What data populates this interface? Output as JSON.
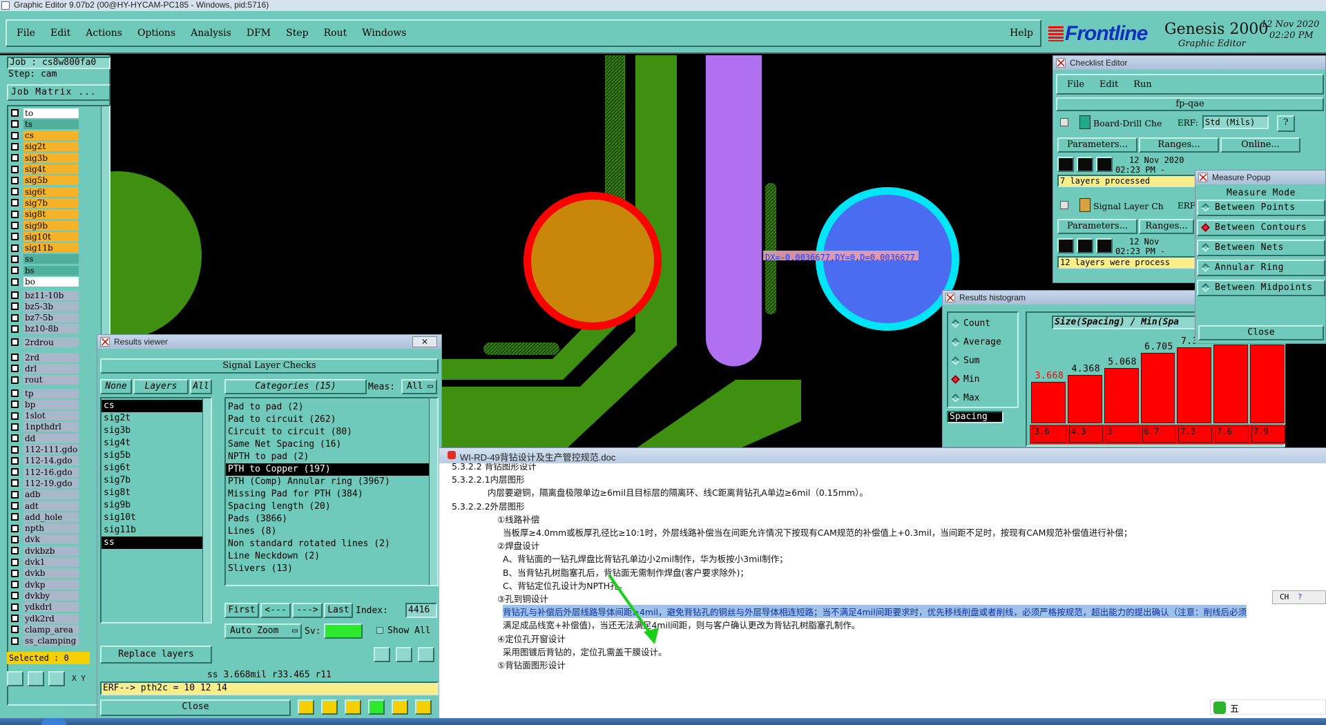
{
  "os_title": "Graphic Editor 9.07b2 (00@HY-HYCAM-PC185 - Windows, pid:5716)",
  "menu": [
    "File",
    "Edit",
    "Actions",
    "Options",
    "Analysis",
    "DFM",
    "Step",
    "Rout",
    "Windows"
  ],
  "help": "Help",
  "logo": {
    "brand": "Frontline",
    "product": "Genesis 2000",
    "subtitle": "Graphic Editor",
    "date": "12 Nov 2020",
    "time": "02:20 PM"
  },
  "job": {
    "job_label": "Job : cs8w800fa0",
    "step_label": "Step: cam",
    "matrix_button": "Job Matrix ..."
  },
  "layers_group1": [
    {
      "name": "to",
      "color": "#ffffff"
    },
    {
      "name": "ts",
      "color": "#4fb09e"
    },
    {
      "name": "cs",
      "color": "#f5b32a"
    },
    {
      "name": "sig2t",
      "color": "#f5b32a"
    },
    {
      "name": "sig3b",
      "color": "#f5b32a"
    },
    {
      "name": "sig4t",
      "color": "#f5b32a"
    },
    {
      "name": "sig5b",
      "color": "#f5b32a"
    },
    {
      "name": "sig6t",
      "color": "#f5b32a"
    },
    {
      "name": "sig7b",
      "color": "#f5b32a"
    },
    {
      "name": "sig8t",
      "color": "#f5b32a"
    },
    {
      "name": "sig9b",
      "color": "#f5b32a"
    },
    {
      "name": "sig10t",
      "color": "#f5b32a"
    },
    {
      "name": "sig11b",
      "color": "#f5b32a"
    },
    {
      "name": "ss",
      "color": "#4fb09e"
    },
    {
      "name": "bs",
      "color": "#4fb09e"
    },
    {
      "name": "bo",
      "color": "#ffffff"
    }
  ],
  "layers_group2": [
    {
      "name": "bz11-10b",
      "color": "#a8b8c8"
    },
    {
      "name": "bz5-3b",
      "color": "#a8b8c8"
    },
    {
      "name": "bz7-5b",
      "color": "#a8b8c8"
    },
    {
      "name": "bz10-8b",
      "color": "#a8b8c8"
    }
  ],
  "layers_group3": [
    {
      "name": "2rdrou",
      "color": "#a8b8c8"
    }
  ],
  "layers_group4": [
    {
      "name": "2rd",
      "color": "#a8b8c8"
    },
    {
      "name": "drl",
      "color": "#a8b8c8"
    },
    {
      "name": "rout",
      "color": "#a8b8c8"
    }
  ],
  "layers_group5": [
    {
      "name": "tp",
      "color": "#a8b8c8"
    },
    {
      "name": "bp",
      "color": "#a8b8c8"
    },
    {
      "name": "1slot",
      "color": "#a8b8c8"
    },
    {
      "name": "1npthdrl",
      "color": "#a8b8c8"
    },
    {
      "name": "dd",
      "color": "#a8b8c8"
    },
    {
      "name": "112-111.gdo",
      "color": "#a8b8c8"
    },
    {
      "name": "112-14.gdo",
      "color": "#a8b8c8"
    },
    {
      "name": "112-16.gdo",
      "color": "#a8b8c8"
    },
    {
      "name": "112-19.gdo",
      "color": "#a8b8c8"
    },
    {
      "name": "adb",
      "color": "#a8b8c8"
    },
    {
      "name": "adt",
      "color": "#a8b8c8"
    },
    {
      "name": "add_hole",
      "color": "#a8b8c8"
    },
    {
      "name": "npth",
      "color": "#a8b8c8"
    },
    {
      "name": "dvk",
      "color": "#a8b8c8"
    },
    {
      "name": "dvkbzb",
      "color": "#a8b8c8"
    },
    {
      "name": "dvk1",
      "color": "#a8b8c8"
    },
    {
      "name": "dvkb",
      "color": "#a8b8c8"
    },
    {
      "name": "dvkp",
      "color": "#a8b8c8"
    },
    {
      "name": "dvkby",
      "color": "#a8b8c8"
    },
    {
      "name": "ydkdrl",
      "color": "#a8b8c8"
    },
    {
      "name": "ydk2rd",
      "color": "#a8b8c8"
    },
    {
      "name": "clamp_area",
      "color": "#a8b8c8"
    },
    {
      "name": "ss_clamping",
      "color": "#a8b8c8"
    }
  ],
  "selected": "Selected : 0",
  "measure_text": "DX=-0.0036677,DY=0,D=0.0036677",
  "results_viewer": {
    "title": "Results viewer",
    "header": "Signal Layer Checks",
    "none_btn": "None",
    "layers_btn": "Layers",
    "all_btn": "All",
    "categories_btn": "Categories (15)",
    "meas_label": "Meas:",
    "meas_value": "All",
    "layers": [
      "cs",
      "sig2t",
      "sig3b",
      "sig4t",
      "sig5b",
      "sig6t",
      "sig7b",
      "sig8t",
      "sig9b",
      "sig10t",
      "sig11b",
      "ss"
    ],
    "categories": [
      "Pad to pad (2)",
      "Pad to circuit (262)",
      "Circuit to circuit (80)",
      "Same Net Spacing (16)",
      "NPTH to pad (2)",
      "PTH to Copper (197)",
      "PTH (Comp) Annular ring (3967)",
      "Missing Pad for PTH (384)",
      "Spacing length (20)",
      "Pads (3866)",
      "Lines (8)",
      "Non standard rotated lines (2)",
      "Line Neckdown (2)",
      "Slivers (13)"
    ],
    "selected_category": "PTH to Copper (197)",
    "nav": {
      "first": "First",
      "prev": "<---",
      "next": "--->",
      "last": "Last",
      "index_label": "Index:",
      "index_value": "4416"
    },
    "auto_zoom": "Auto Zoom",
    "sv_label": "Sv:",
    "show_all": "Show All",
    "replace_layers": "Replace layers",
    "status": "ss 3.668mil  r33.465  r11",
    "erf": "ERF--> pth2c = 10 12 14",
    "close": "Close"
  },
  "checklist": {
    "title": "Checklist Editor",
    "menu": [
      "File",
      "Edit",
      "Run"
    ],
    "name": "fp-qae",
    "check1": {
      "label": "Board-Drill Che",
      "erf": "ERF:",
      "erf_value": "Std (Mils)",
      "date": "12 Nov 2020",
      "time": "02:23 PM -",
      "status": "7 layers processed"
    },
    "check2": {
      "label": "Signal Layer Ch",
      "erf": "ERF",
      "date": "12 Nov",
      "time": "02:23 PM -",
      "status": "12 layers were process"
    },
    "params": "Parameters...",
    "ranges": "Ranges...",
    "online": "Online..."
  },
  "measure_popup": {
    "title": "Measure Popup",
    "header": "Measure Mode",
    "modes": [
      "Between Points",
      "Between Contours",
      "Between Nets",
      "Annular Ring",
      "Between Midpoints"
    ],
    "selected": "Between Contours",
    "close": "Close"
  },
  "histogram": {
    "title": "Results histogram",
    "options": [
      "Count",
      "Average",
      "Sum",
      "Min",
      "Max"
    ],
    "selected": "Min",
    "field": "Spacing",
    "chart_title": "Size(Spacing) / Min(Spa",
    "chart_data": {
      "type": "bar",
      "values": [
        3.668,
        4.368,
        5.068,
        6.705,
        7.305,
        7.605,
        7.905
      ],
      "categories": [
        "3.6-",
        "4.3-",
        "5-",
        "6.7-",
        "7.3-",
        "7.6-",
        "7.9-"
      ]
    }
  },
  "doc": {
    "title": "WI-RD-49背钻设计及生产管控规范.doc",
    "lines": [
      {
        "t": "5.3.2.2 背钻图形设计",
        "indent": 0
      },
      {
        "t": "5.3.2.2.1内层图形",
        "indent": 0
      },
      {
        "t": "内层要避铜，隔离盘极限单边≥6mil且目标层的隔离环、线C距离背钻孔A单边≥6mil（0.15mm）。",
        "indent": 1
      },
      {
        "t": "5.3.2.2.2外层图形",
        "indent": 0
      },
      {
        "t": "①线路补偿",
        "indent": 2
      },
      {
        "t": "当板厚≥4.0mm或板厚孔径比≥10:1时，外层线路补偿当在间距允许情况下按现有CAM规范的补偿值上+0.3mil，当间距不足时，按现有CAM规范补偿值进行补偿；",
        "indent": 3
      },
      {
        "t": "②焊盘设计",
        "indent": 2
      },
      {
        "t": "A、背钻面的一钻孔焊盘比背钻孔单边小2mil制作，华为板按小3mil制作；",
        "indent": 3
      },
      {
        "t": "B、当背钻孔树脂塞孔后，背钻面无需制作焊盘(客户要求除外)；",
        "indent": 3
      },
      {
        "t": "C、背钻定位孔设计为NPTH孔。",
        "indent": 3
      },
      {
        "t": "③孔到铜设计",
        "indent": 2
      },
      {
        "t": "背钻孔与补偿后外层线路导体间距≥4mil，避免背钻孔的铜丝与外层导体相连短路；当不满足4mil间距要求时，优先移线削盘或者削线，必须严格按规范，超出能力的提出确认（注意：削线后必须",
        "indent": 3,
        "hl": true
      },
      {
        "t": "满足成品线宽+补偿值)，当还无法满足4mil间距，则与客户确认更改为背钻孔树脂塞孔制作。",
        "indent": 3
      },
      {
        "t": "④定位孔开窗设计",
        "indent": 2
      },
      {
        "t": "采用图镀后背钻的，定位孔需盖干膜设计。",
        "indent": 3
      },
      {
        "t": "⑤背钻面图形设计",
        "indent": 2
      }
    ]
  },
  "ime": {
    "label": "五",
    "lang": "CH"
  }
}
